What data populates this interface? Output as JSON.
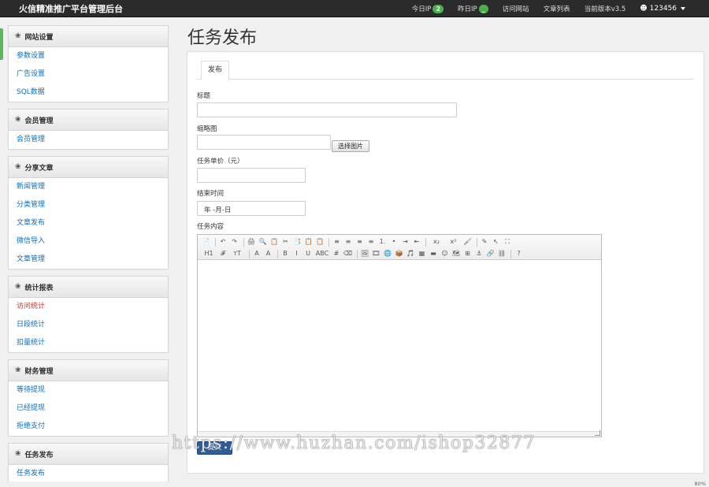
{
  "navbar": {
    "brand": "火信精准推广平台管理后台",
    "today_ip_label": "今日IP",
    "today_ip_count": "2",
    "yesterday_ip_label": "昨日IP",
    "yesterday_ip_count": "_",
    "visit_site": "访问网站",
    "article_list": "文章列表",
    "version": "当前版本v3.5",
    "user": "123456"
  },
  "sidebar": {
    "groups": [
      {
        "title": "网站设置",
        "items": [
          "参数设置",
          "广告设置",
          "SQL数据"
        ]
      },
      {
        "title": "会员管理",
        "items": [
          "会员管理"
        ]
      },
      {
        "title": "分享文章",
        "items": [
          "新闻管理",
          "分类管理",
          "文章发布",
          "微信导入",
          "文章管理"
        ]
      },
      {
        "title": "统计报表",
        "items": [
          "访问统计",
          "日段统计",
          "扣量统计"
        ]
      },
      {
        "title": "财务管理",
        "items": [
          "等待提现",
          "已经提现",
          "拒绝支付"
        ]
      },
      {
        "title": "任务发布",
        "items": [
          "任务发布"
        ]
      }
    ]
  },
  "main": {
    "page_title": "任务发布",
    "tab_label": "发布",
    "title_label": "标题",
    "thumb_label": "缩略图",
    "select_image_button": "选择图片",
    "price_label": "任务单价（元）",
    "end_time_label": "结束时间",
    "date_placeholder": "年 -月-日",
    "content_label": "任务内容",
    "toolbar_row1": [
      "📄",
      "↶",
      "↷",
      "🖨",
      "🔍",
      "📋",
      "✂",
      "📑",
      "📋",
      "📋",
      "≡",
      "≡",
      "≡",
      "≡",
      "1.",
      "•",
      "⇥",
      "⇤",
      "x₂",
      "x²",
      "🖌",
      "✎",
      "↖",
      "⛶"
    ],
    "toolbar_row2": [
      "H1",
      "𝓕",
      "тT",
      "A",
      "A",
      "B",
      "I",
      "U",
      "ABC",
      "#",
      "⌫",
      "🖼",
      "🎞",
      "🌐",
      "📦",
      "🎵",
      "▦",
      "▬",
      "☺",
      "🗺",
      "⊞",
      "⚓",
      "🔗",
      "⛓",
      "?"
    ],
    "submit_button": "提交"
  },
  "watermark": "https://www.huzhan.com/ishop32877",
  "status": {
    "zoom": "80%"
  }
}
